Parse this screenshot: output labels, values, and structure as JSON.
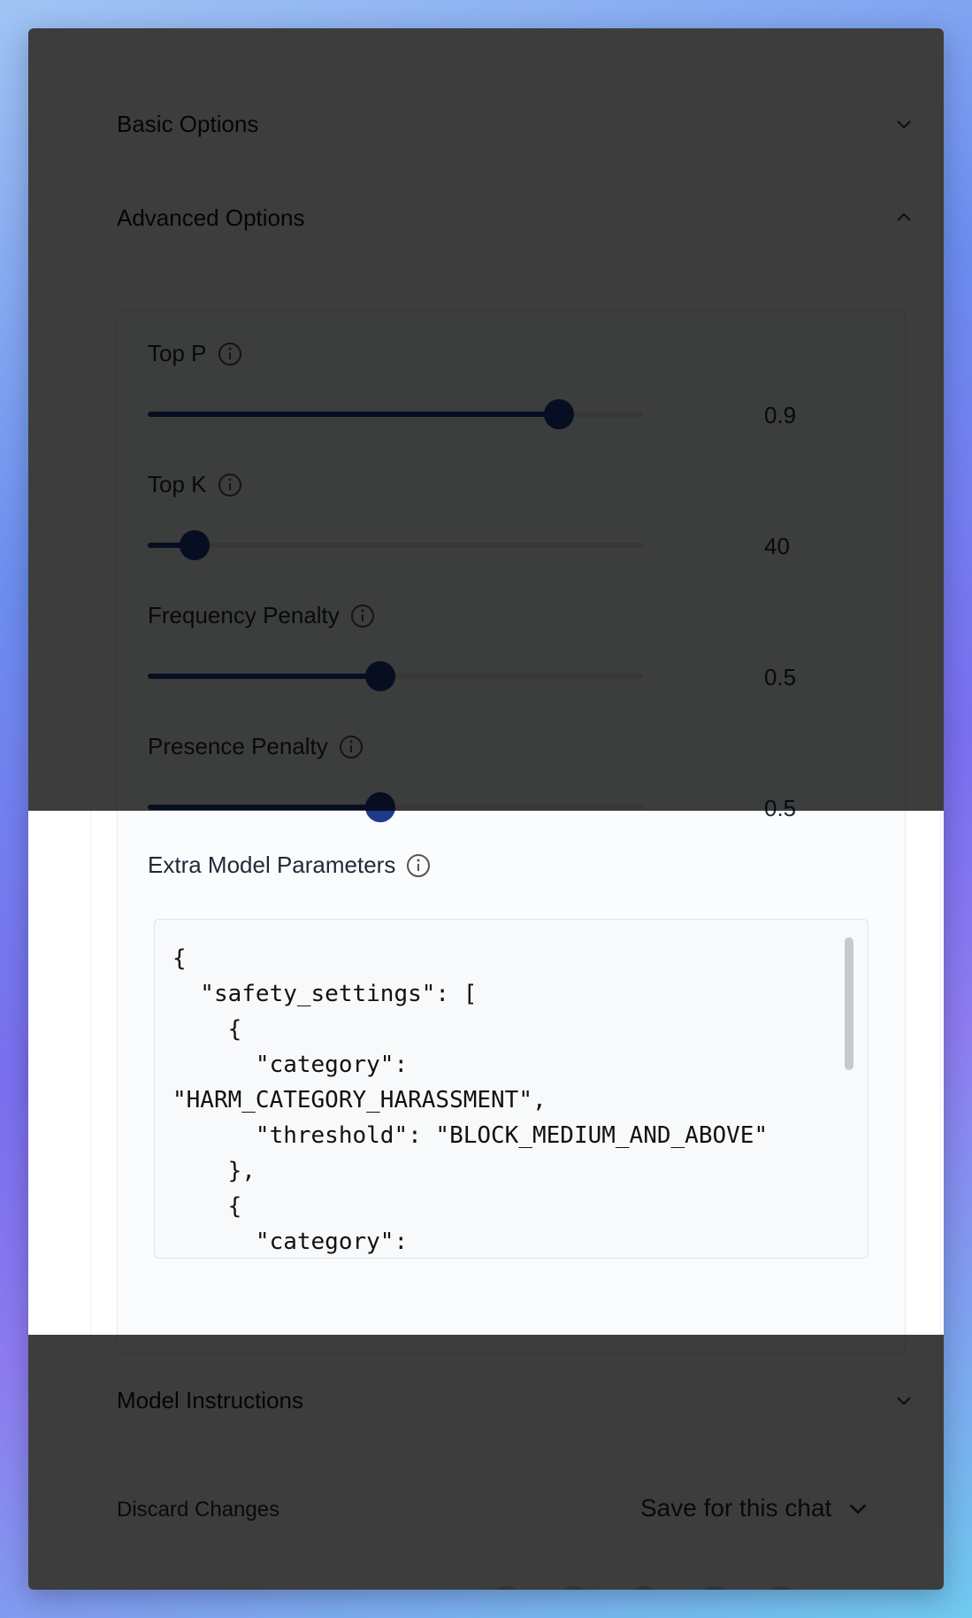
{
  "sections": {
    "basic": {
      "label": "Basic Options"
    },
    "advanced": {
      "label": "Advanced Options"
    },
    "instructions": {
      "label": "Model Instructions"
    }
  },
  "params": [
    {
      "label": "Top P",
      "value_text": "0.9",
      "fraction": 0.83
    },
    {
      "label": "Top K",
      "value_text": "40",
      "fraction": 0.095
    },
    {
      "label": "Frequency Penalty",
      "value_text": "0.5",
      "fraction": 0.47
    },
    {
      "label": "Presence Penalty",
      "value_text": "0.5",
      "fraction": 0.47
    }
  ],
  "extra": {
    "label": "Extra Model Parameters",
    "code": "{\n  \"safety_settings\": [\n    {\n      \"category\":\n\"HARM_CATEGORY_HARASSMENT\",\n      \"threshold\": \"BLOCK_MEDIUM_AND_ABOVE\"\n    },\n    {\n      \"category\":"
  },
  "footer": {
    "discard_label": "Discard Changes",
    "save_label": "Save for this chat"
  },
  "colors": {
    "slider_accent": "#1e3a8a",
    "overlay": "rgba(0,0,0,0.76)"
  }
}
